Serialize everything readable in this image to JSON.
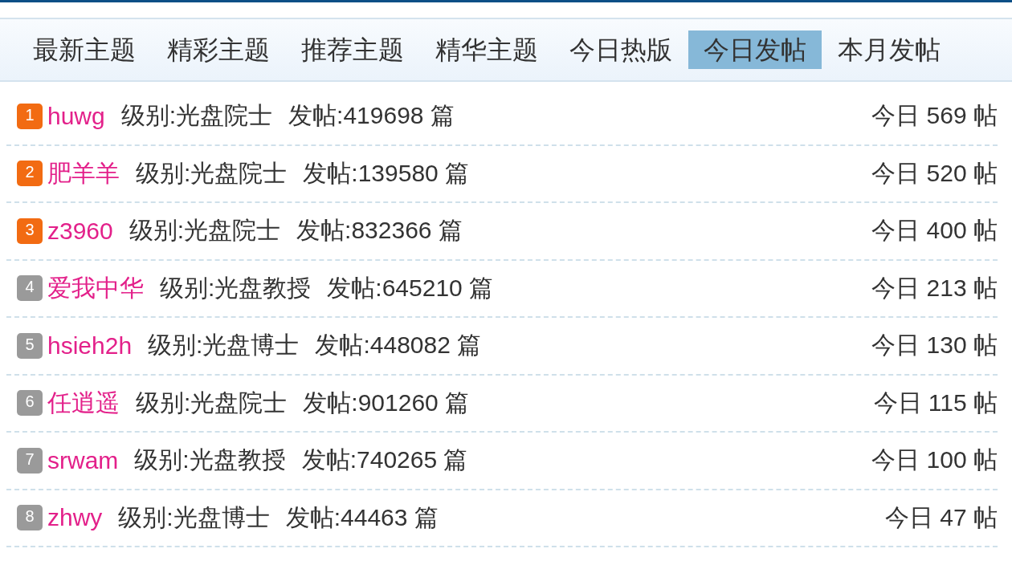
{
  "tabs": [
    {
      "label": "最新主题",
      "selected": false
    },
    {
      "label": "精彩主题",
      "selected": false
    },
    {
      "label": "推荐主题",
      "selected": false
    },
    {
      "label": "精华主题",
      "selected": false
    },
    {
      "label": "今日热版",
      "selected": false
    },
    {
      "label": "今日发帖",
      "selected": true
    },
    {
      "label": "本月发帖",
      "selected": false
    }
  ],
  "ranking": [
    {
      "rank": "1",
      "color": "#f26b12",
      "username": "huwg",
      "level": "级别:光盘院士",
      "posts": "发帖:419698 篇",
      "today": "今日 569 帖"
    },
    {
      "rank": "2",
      "color": "#f26b12",
      "username": "肥羊羊",
      "level": "级别:光盘院士",
      "posts": "发帖:139580 篇",
      "today": "今日 520 帖"
    },
    {
      "rank": "3",
      "color": "#f26b12",
      "username": "z3960",
      "level": "级别:光盘院士",
      "posts": "发帖:832366 篇",
      "today": "今日 400 帖"
    },
    {
      "rank": "4",
      "color": "#9a9a9a",
      "username": "爱我中华",
      "level": "级别:光盘教授",
      "posts": "发帖:645210 篇",
      "today": "今日 213 帖"
    },
    {
      "rank": "5",
      "color": "#9a9a9a",
      "username": "hsieh2h",
      "level": "级别:光盘博士",
      "posts": "发帖:448082 篇",
      "today": "今日 130 帖"
    },
    {
      "rank": "6",
      "color": "#9a9a9a",
      "username": "任逍遥",
      "level": "级别:光盘院士",
      "posts": "发帖:901260 篇",
      "today": "今日 115 帖"
    },
    {
      "rank": "7",
      "color": "#9a9a9a",
      "username": "srwam",
      "level": "级别:光盘教授",
      "posts": "发帖:740265 篇",
      "today": "今日 100 帖"
    },
    {
      "rank": "8",
      "color": "#9a9a9a",
      "username": "zhwy",
      "level": "级别:光盘博士",
      "posts": "发帖:44463 篇",
      "today": "今日 47 帖"
    }
  ]
}
